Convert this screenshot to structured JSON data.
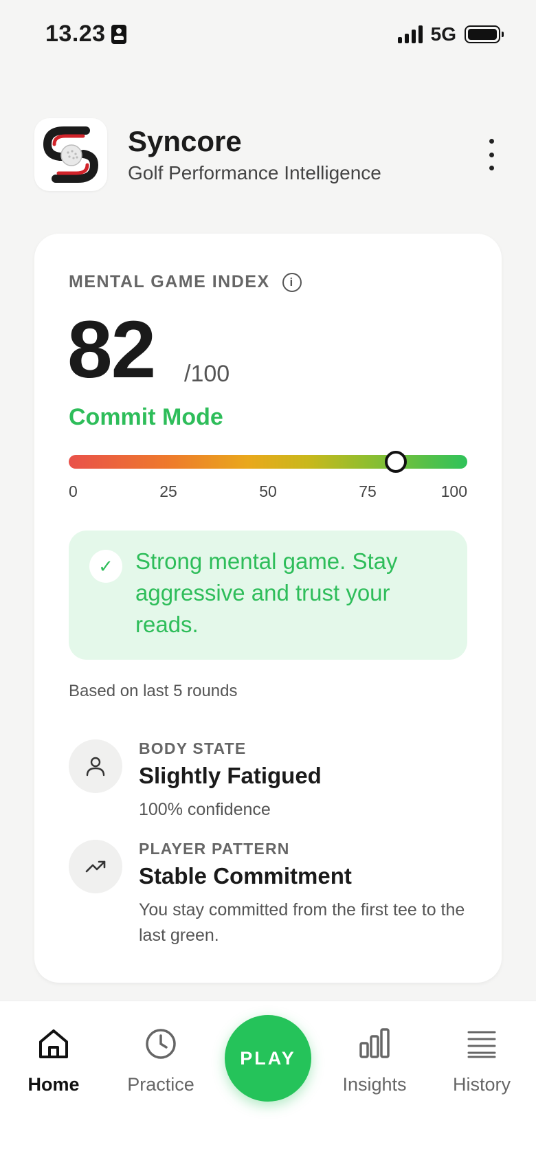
{
  "status_bar": {
    "time": "13.23",
    "network": "5G"
  },
  "header": {
    "app_name": "Syncore",
    "tagline": "Golf Performance Intelligence"
  },
  "mental_index": {
    "title": "MENTAL GAME INDEX",
    "info_icon": "i",
    "score": "82",
    "max": "/100",
    "score_fraction": 0.82,
    "mode": "Commit Mode",
    "ticks": [
      "0",
      "25",
      "50",
      "75",
      "100"
    ],
    "advice": "Strong mental game. Stay aggressive and trust your reads.",
    "advice_icon": "✓",
    "based_on": "Based on last 5 rounds"
  },
  "body_state": {
    "label": "BODY STATE",
    "value": "Slightly Fatigued",
    "sub": "100% confidence",
    "icon": "person-icon"
  },
  "player_pattern": {
    "label": "PLAYER PATTERN",
    "value": "Stable Commitment",
    "sub": "You stay committed from the first tee to the last green.",
    "icon": "trend-up-icon"
  },
  "tabs": {
    "home": "Home",
    "practice": "Practice",
    "play": "PLAY",
    "insights": "Insights",
    "history": "History"
  },
  "colors": {
    "accent_green": "#2ebd5a",
    "play_green": "#25c35a",
    "advice_bg": "#e4f8ea"
  }
}
